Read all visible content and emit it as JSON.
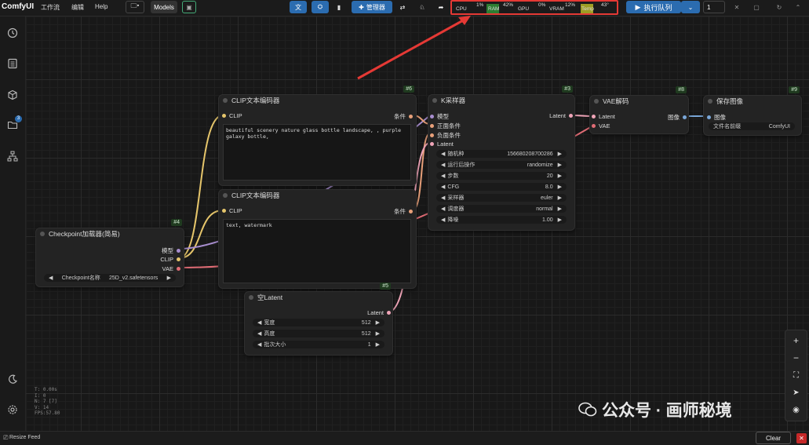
{
  "topbar": {
    "brand": "ComfyUI",
    "menu": [
      "工作流",
      "编辑",
      "Help"
    ],
    "models_label": "Models",
    "manager_label": "管理器",
    "queue_label": "执行队列",
    "queue_count": "1"
  },
  "monitor": {
    "cpu_label": "CPU",
    "cpu_value": "1%",
    "ram_label": "RAM",
    "ram_value": "42%",
    "gpu_label": "GPU",
    "gpu_value": "0%",
    "vram_label": "VRAM",
    "vram_value": "12%",
    "temp_label": "Temp",
    "temp_value": "43°"
  },
  "sidebar": {
    "badge": "3"
  },
  "nodes": {
    "checkpoint": {
      "id": "#4",
      "title": "Checkpoint加载器(简易)",
      "out_model": "模型",
      "out_clip": "CLIP",
      "out_vae": "VAE",
      "w_label": "Checkpoint名称",
      "w_value": "25D_v2.safetensors"
    },
    "clip_pos": {
      "id": "#6",
      "title": "CLIP文本编码器",
      "in_clip": "CLIP",
      "out_cond": "条件",
      "text": "beautiful scenery nature glass bottle landscape, , purple galaxy bottle,"
    },
    "clip_neg": {
      "id": "#7",
      "title": "CLIP文本编码器",
      "in_clip": "CLIP",
      "out_cond": "条件",
      "text": "text, watermark"
    },
    "ksampler": {
      "id": "#3",
      "title": "K采样器",
      "in_model": "模型",
      "in_pos": "正面条件",
      "in_neg": "负面条件",
      "in_latent": "Latent",
      "out_latent": "Latent",
      "widgets": [
        {
          "label": "随机种",
          "value": "156680208700286"
        },
        {
          "label": "运行后操作",
          "value": "randomize"
        },
        {
          "label": "步数",
          "value": "20"
        },
        {
          "label": "CFG",
          "value": "8.0"
        },
        {
          "label": "采样器",
          "value": "euler"
        },
        {
          "label": "调度器",
          "value": "normal"
        },
        {
          "label": "降噪",
          "value": "1.00"
        }
      ]
    },
    "vae": {
      "id": "#8",
      "title": "VAE解码",
      "in_latent": "Latent",
      "in_vae": "VAE",
      "out_image": "图像"
    },
    "save": {
      "id": "#9",
      "title": "保存图像",
      "in_image": "图像",
      "w_label": "文件名前缀",
      "w_value": "ComfyUI"
    },
    "latent": {
      "id": "#5",
      "title": "空Latent",
      "out_latent": "Latent",
      "widgets": [
        {
          "label": "宽度",
          "value": "512"
        },
        {
          "label": "高度",
          "value": "512"
        },
        {
          "label": "批次大小",
          "value": "1"
        }
      ]
    }
  },
  "stats": [
    "T: 0.00s",
    "I: 0",
    "N: 7 [7]",
    "V: 14",
    "FPS:57.80"
  ],
  "statusbar": {
    "resize_feed": "Resize Feed",
    "clear": "Clear"
  },
  "watermark": "公众号 · 画师秘境",
  "colors": {
    "accent": "#2b6cb0",
    "annotation": "#e53935",
    "clip_wire": "#e5c56b",
    "model_wire": "#a88ecf",
    "vae_wire": "#e06c75",
    "cond_wire": "#e8a07a",
    "latent_wire": "#f0a5b8",
    "image_wire": "#7aa7d8"
  }
}
